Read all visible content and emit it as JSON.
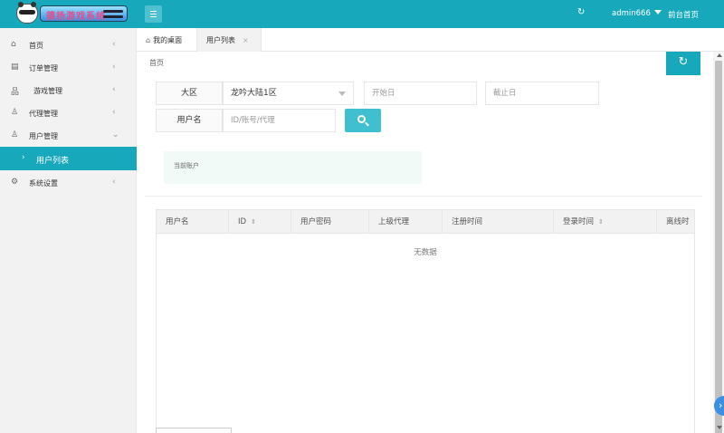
{
  "header": {
    "logo_text": "德扬游戏系统",
    "refresh_icon": "refresh-icon",
    "user": "admin666",
    "front_link": "前台首页"
  },
  "sidebar": {
    "items": [
      {
        "label": "首页",
        "icon": "home-icon"
      },
      {
        "label": "订单管理",
        "icon": "order-icon"
      },
      {
        "label": "游戏管理",
        "icon": "sitemap-icon"
      },
      {
        "label": "代理管理",
        "icon": "agent-icon"
      },
      {
        "label": "用户管理",
        "icon": "user-icon"
      },
      {
        "label": "用户列表",
        "icon": "chevron-right-icon"
      },
      {
        "label": "系统设置",
        "icon": "gear-icon"
      }
    ]
  },
  "tabs": [
    {
      "label": "我的桌面"
    },
    {
      "label": "用户列表"
    }
  ],
  "breadcrumb": "首页",
  "form": {
    "region_label": "大区",
    "region_value": "龙吟大陆1区",
    "start_placeholder": "开始日",
    "end_placeholder": "截止日",
    "user_label": "用户名",
    "user_placeholder": "ID/账号/代理"
  },
  "account_box": "当前账户",
  "table": {
    "columns": [
      "用户名",
      "ID",
      "用户密码",
      "上级代理",
      "注册时间",
      "登录时间",
      "离线时"
    ],
    "empty_text": "无数据"
  },
  "colors": {
    "accent": "#17a8bb",
    "sidebar_bg": "#f2f2f2"
  }
}
